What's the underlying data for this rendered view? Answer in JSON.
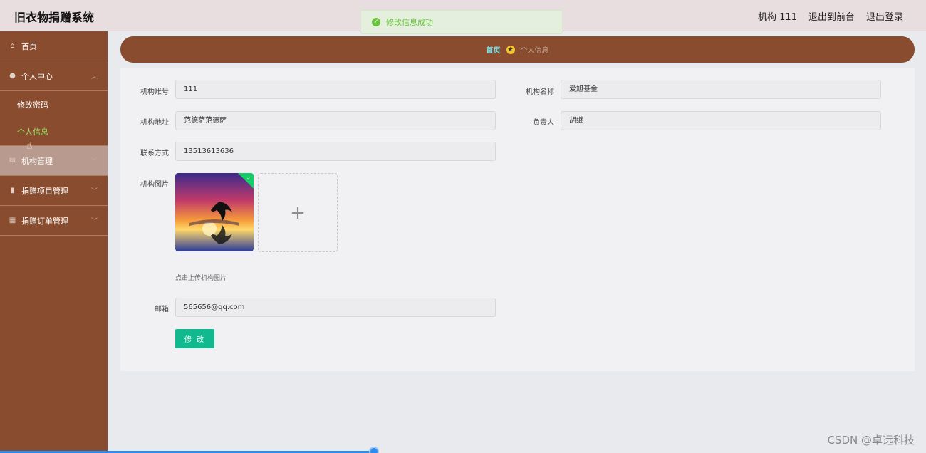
{
  "app": {
    "title": "旧衣物捐赠系统"
  },
  "header": {
    "user": "机构 111",
    "to_front": "退出到前台",
    "logout": "退出登录"
  },
  "toast": {
    "message": "修改信息成功",
    "color": "#67c23a"
  },
  "sidebar": {
    "home": "首页",
    "personal_center": "个人中心",
    "sub_items": [
      "修改密码",
      "个人信息"
    ],
    "org_manage": "机构管理",
    "project_manage": "捐赠项目管理",
    "order_manage": "捐赠订单管理"
  },
  "breadcrumb": {
    "home": "首页",
    "current": "个人信息"
  },
  "form": {
    "account_label": "机构账号",
    "account_value": "111",
    "name_label": "机构名称",
    "name_value": "爱旭基金",
    "address_label": "机构地址",
    "address_value": "范德萨范德萨",
    "leader_label": "负责人",
    "leader_value": "胡继",
    "phone_label": "联系方式",
    "phone_value": "13513613636",
    "image_label": "机构图片",
    "upload_hint": "点击上传机构图片",
    "email_label": "邮箱",
    "email_value": "565656@qq.com",
    "submit": "修 改"
  },
  "watermark": "CSDN @卓远科技",
  "colors": {
    "sidebar": "#8a4c2e",
    "accent_green": "#12b98f",
    "active_sub": "#9fe065"
  }
}
